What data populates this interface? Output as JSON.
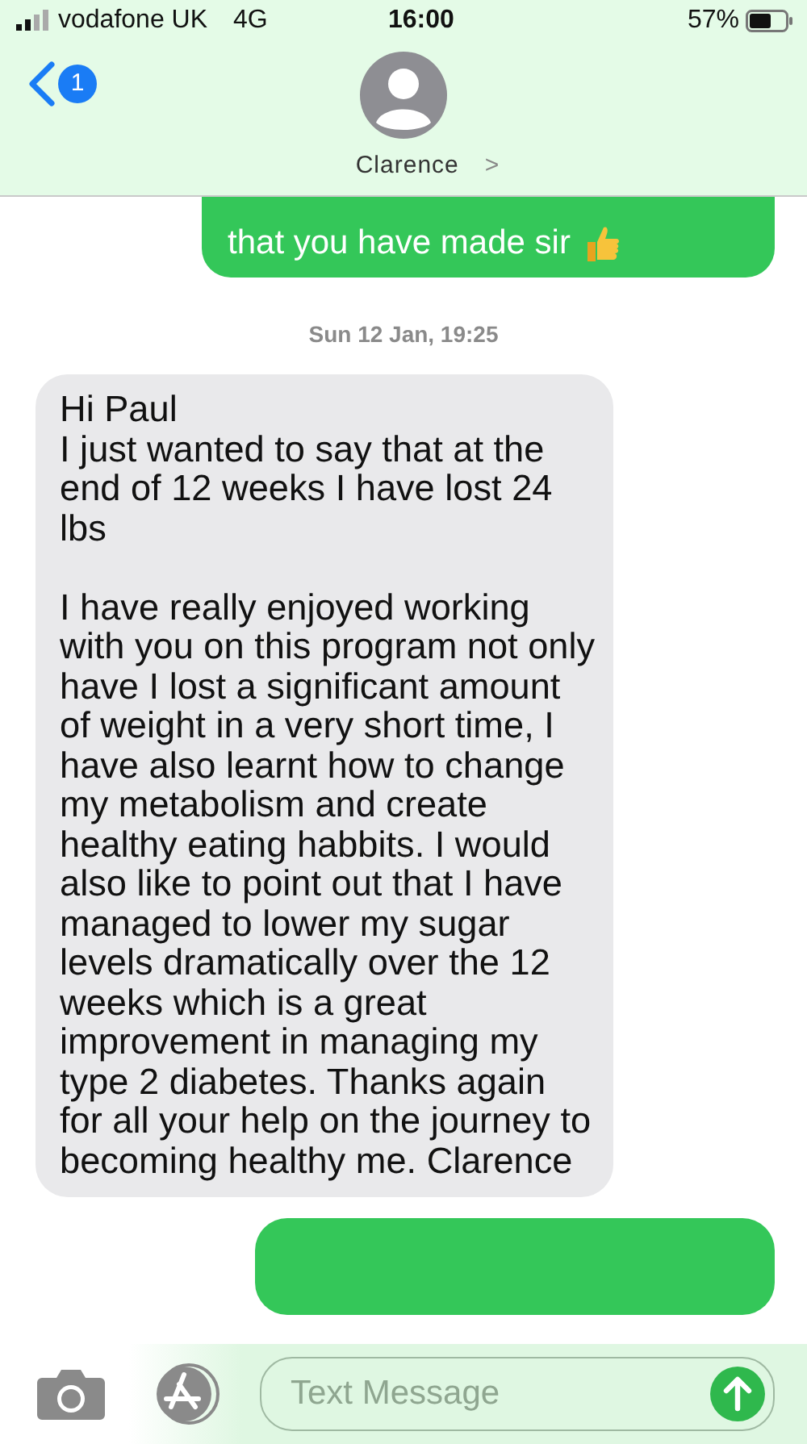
{
  "status_bar": {
    "carrier": "vodafone UK",
    "network": "4G",
    "time": "16:00",
    "battery": "57%"
  },
  "header": {
    "back_badge": "1",
    "contact": "Clarence",
    "chevron": ">"
  },
  "messages": [
    {
      "kind": "sent",
      "text": "that you have made sir"
    },
    {
      "kind": "timestamp",
      "text": "Sun 12 Jan, 19:25"
    },
    {
      "kind": "received",
      "paragraphs": [
        {
          "lines": [
            "Hi Paul",
            "I just wanted to say that at the end of 12 weeks I have lost 24 lbs"
          ]
        },
        {
          "lines": [
            "I have really enjoyed working with you on this program not only have I lost a significant amount of weight in a very short time, I have also learnt how to change my metabolism and create healthy eating habbits. I would also like to point out that I have managed to lower my sugar levels dramatically over the 12 weeks which is a great improvement in managing my type 2 diabetes. Thanks again for all your help on the journey to becoming healthy me. Clarence"
          ]
        }
      ]
    },
    {
      "kind": "sent_hidden"
    }
  ],
  "composer": {
    "placeholder": "Text Message"
  }
}
